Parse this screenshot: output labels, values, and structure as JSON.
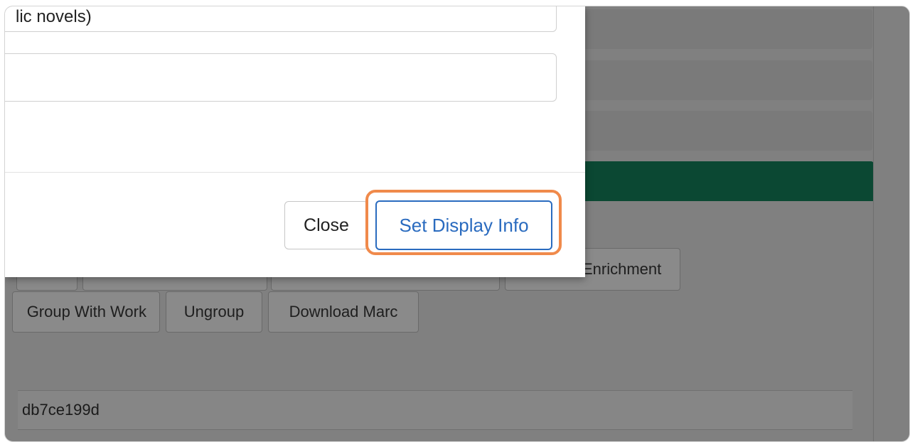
{
  "modal": {
    "field_1_text": "lic novels)",
    "field_2_text": "",
    "close_label": "Close",
    "set_display_label": "Set Display Info"
  },
  "background": {
    "buttons_row1": [
      "",
      "",
      "",
      "Enrichment"
    ],
    "buttons_row2": [
      "Group With Work",
      "Ungroup",
      "Download Marc"
    ],
    "id_value": "db7ce199d"
  },
  "colors": {
    "overlay": "#808080",
    "header_green": "#0b4833",
    "highlight_orange": "#f08a4b",
    "primary_blue": "#2a6bbf"
  }
}
